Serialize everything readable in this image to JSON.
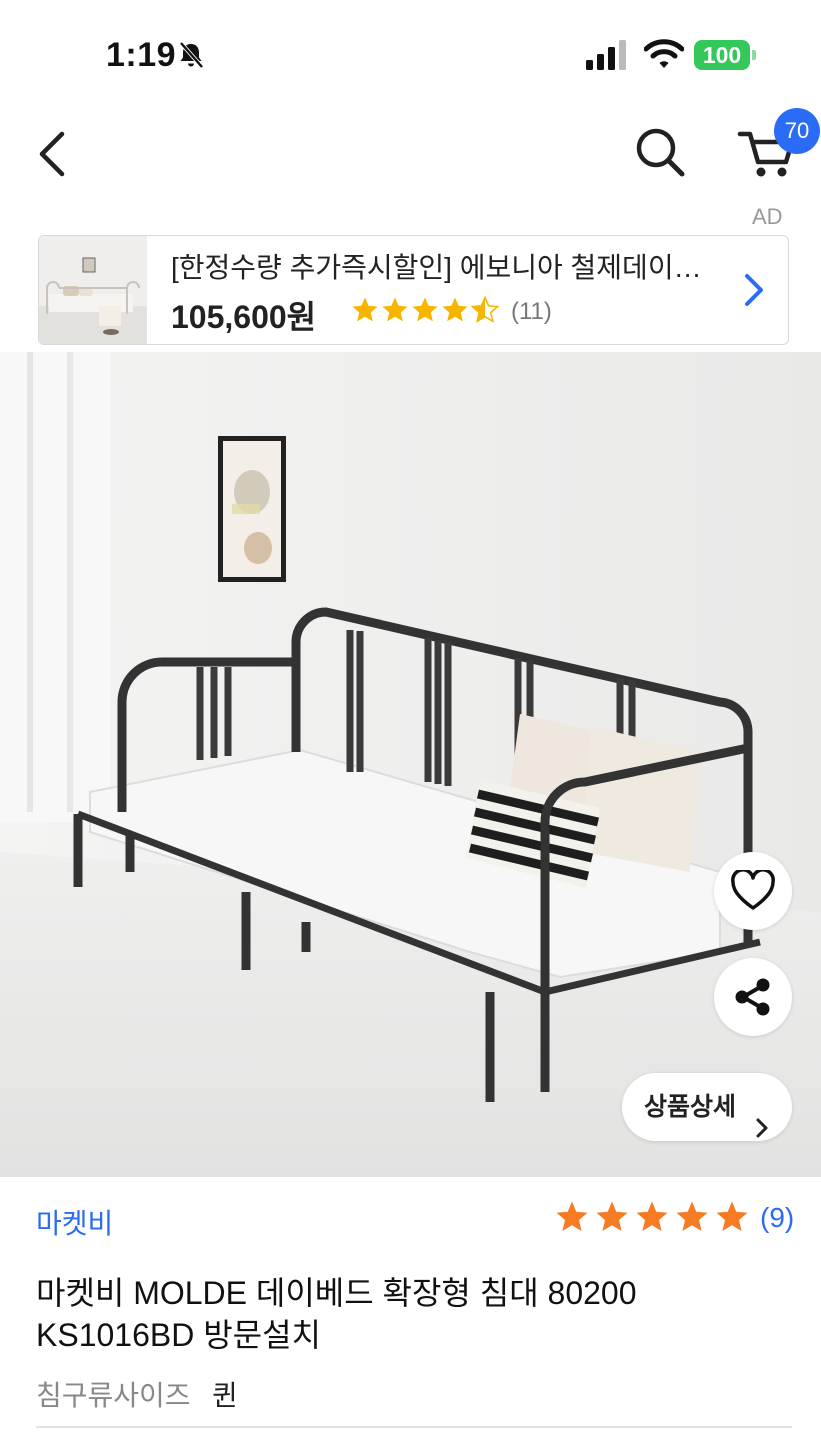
{
  "status_bar": {
    "time": "1:19",
    "battery": "100"
  },
  "header": {
    "cart_count": "70"
  },
  "ad": {
    "label": "AD",
    "title": "[한정수량 추가즉시할인] 에보니아 철제데이…",
    "price": "105,600원",
    "rating": 4.5,
    "review_count": "(11)"
  },
  "hero": {
    "detail_button": "상품상세"
  },
  "product": {
    "seller": "마켓비",
    "rating": 5,
    "review_count": "(9)",
    "title": "마켓비 MOLDE 데이베드 확장형 침대 80200 KS1016BD 방문설치",
    "option_label": "침구류사이즈",
    "option_value": "퀸"
  },
  "colors": {
    "accent_blue": "#2a6cf5",
    "star_gold": "#f7b500",
    "star_orange": "#f57c22",
    "battery_green": "#34c759"
  },
  "icons": [
    "bell-slash-icon",
    "signal-icon",
    "wifi-icon",
    "back-icon",
    "search-icon",
    "cart-icon",
    "chevron-right-icon",
    "heart-icon",
    "share-icon",
    "star-icon"
  ]
}
